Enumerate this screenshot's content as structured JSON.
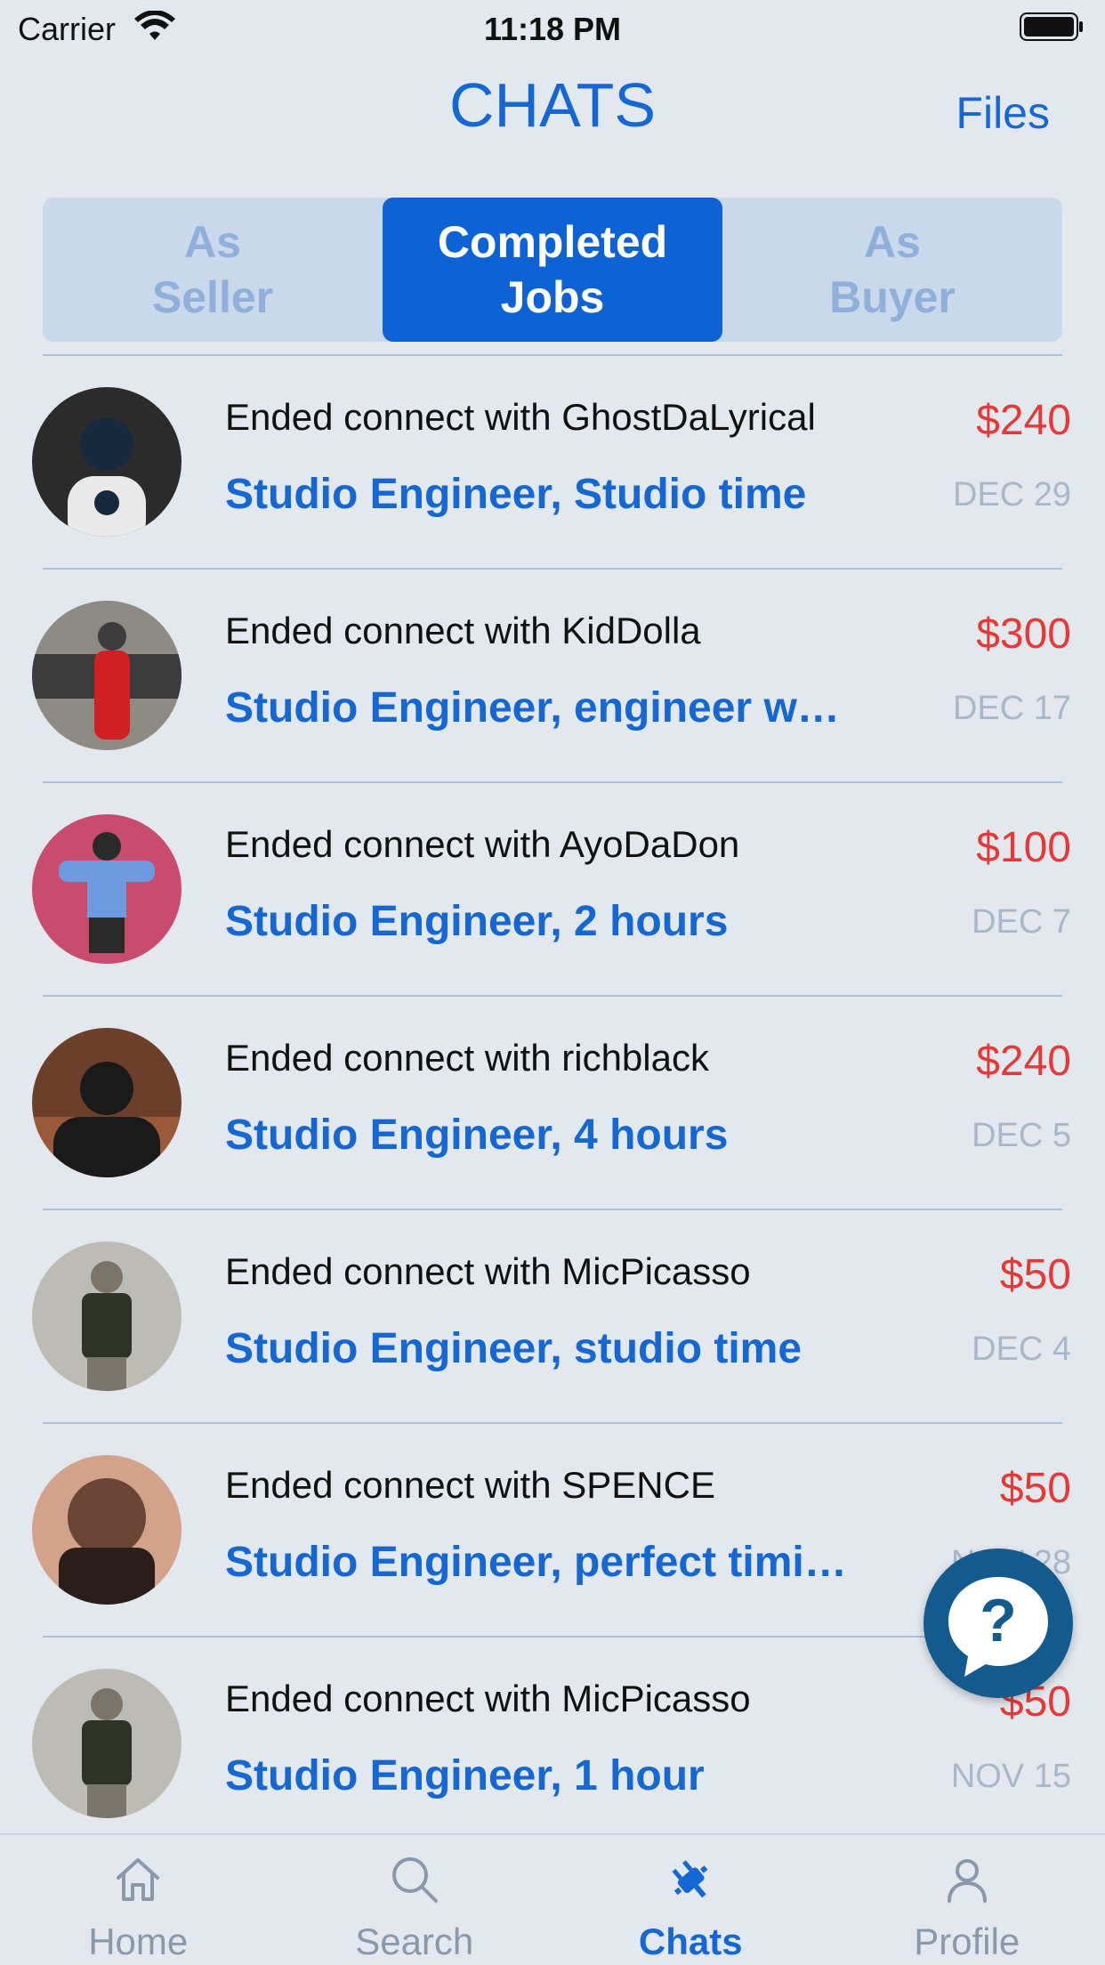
{
  "status_bar": {
    "carrier": "Carrier",
    "time": "11:18 PM"
  },
  "header": {
    "title": "CHATS",
    "files_label": "Files"
  },
  "segments": [
    {
      "label": "As\nSeller",
      "active": false
    },
    {
      "label": "Completed\nJobs",
      "active": true
    },
    {
      "label": "As\nBuyer",
      "active": false
    }
  ],
  "chats": [
    {
      "title": "Ended connect with GhostDaLyrical",
      "subtitle": "Studio Engineer, Studio time",
      "price": "$240",
      "date": "DEC 29",
      "avatar_colors": [
        "#2b2b2b",
        "#e9e9e9",
        "#16293f"
      ]
    },
    {
      "title": "Ended connect with KidDolla",
      "subtitle": "Studio Engineer, engineer work",
      "price": "$300",
      "date": "DEC 17",
      "avatar_colors": [
        "#8e8a84",
        "#d11f24",
        "#3c3c3c"
      ]
    },
    {
      "title": "Ended connect with AyoDaDon",
      "subtitle": "Studio Engineer, 2 hours",
      "price": "$100",
      "date": "DEC 7",
      "avatar_colors": [
        "#c94c6e",
        "#6e9be0",
        "#2a2a2a"
      ]
    },
    {
      "title": "Ended connect with richblack",
      "subtitle": "Studio Engineer, 4 hours",
      "price": "$240",
      "date": "DEC 5",
      "avatar_colors": [
        "#6b3f2a",
        "#1a1a1a",
        "#9a5a3a"
      ]
    },
    {
      "title": "Ended connect with MicPicasso",
      "subtitle": "Studio Engineer, studio time",
      "price": "$50",
      "date": "DEC 4",
      "avatar_colors": [
        "#bcbcb4",
        "#2d3326",
        "#7a7568"
      ]
    },
    {
      "title": "Ended connect with SPENCE",
      "subtitle": "Studio Engineer, perfect timin…",
      "price": "$50",
      "date": "NOV 28",
      "avatar_colors": [
        "#d3a28a",
        "#2a1e1a",
        "#6a4636"
      ]
    },
    {
      "title": "Ended connect with MicPicasso",
      "subtitle": "Studio Engineer, 1 hour",
      "price": "$50",
      "date": "NOV 15",
      "avatar_colors": [
        "#bcbcb4",
        "#2d3326",
        "#7a7568"
      ]
    }
  ],
  "help_button": {
    "icon": "question-bubble-icon",
    "color": "#135a8f"
  },
  "tabbar": [
    {
      "label": "Home",
      "icon": "home-icon",
      "active": false
    },
    {
      "label": "Search",
      "icon": "search-icon",
      "active": false
    },
    {
      "label": "Chats",
      "icon": "plug-icon",
      "active": true
    },
    {
      "label": "Profile",
      "icon": "person-icon",
      "active": false
    }
  ],
  "colors": {
    "accent": "#1568d4",
    "price": "#e53935",
    "date": "#a9b8c8",
    "background": "#e3e8ee"
  }
}
